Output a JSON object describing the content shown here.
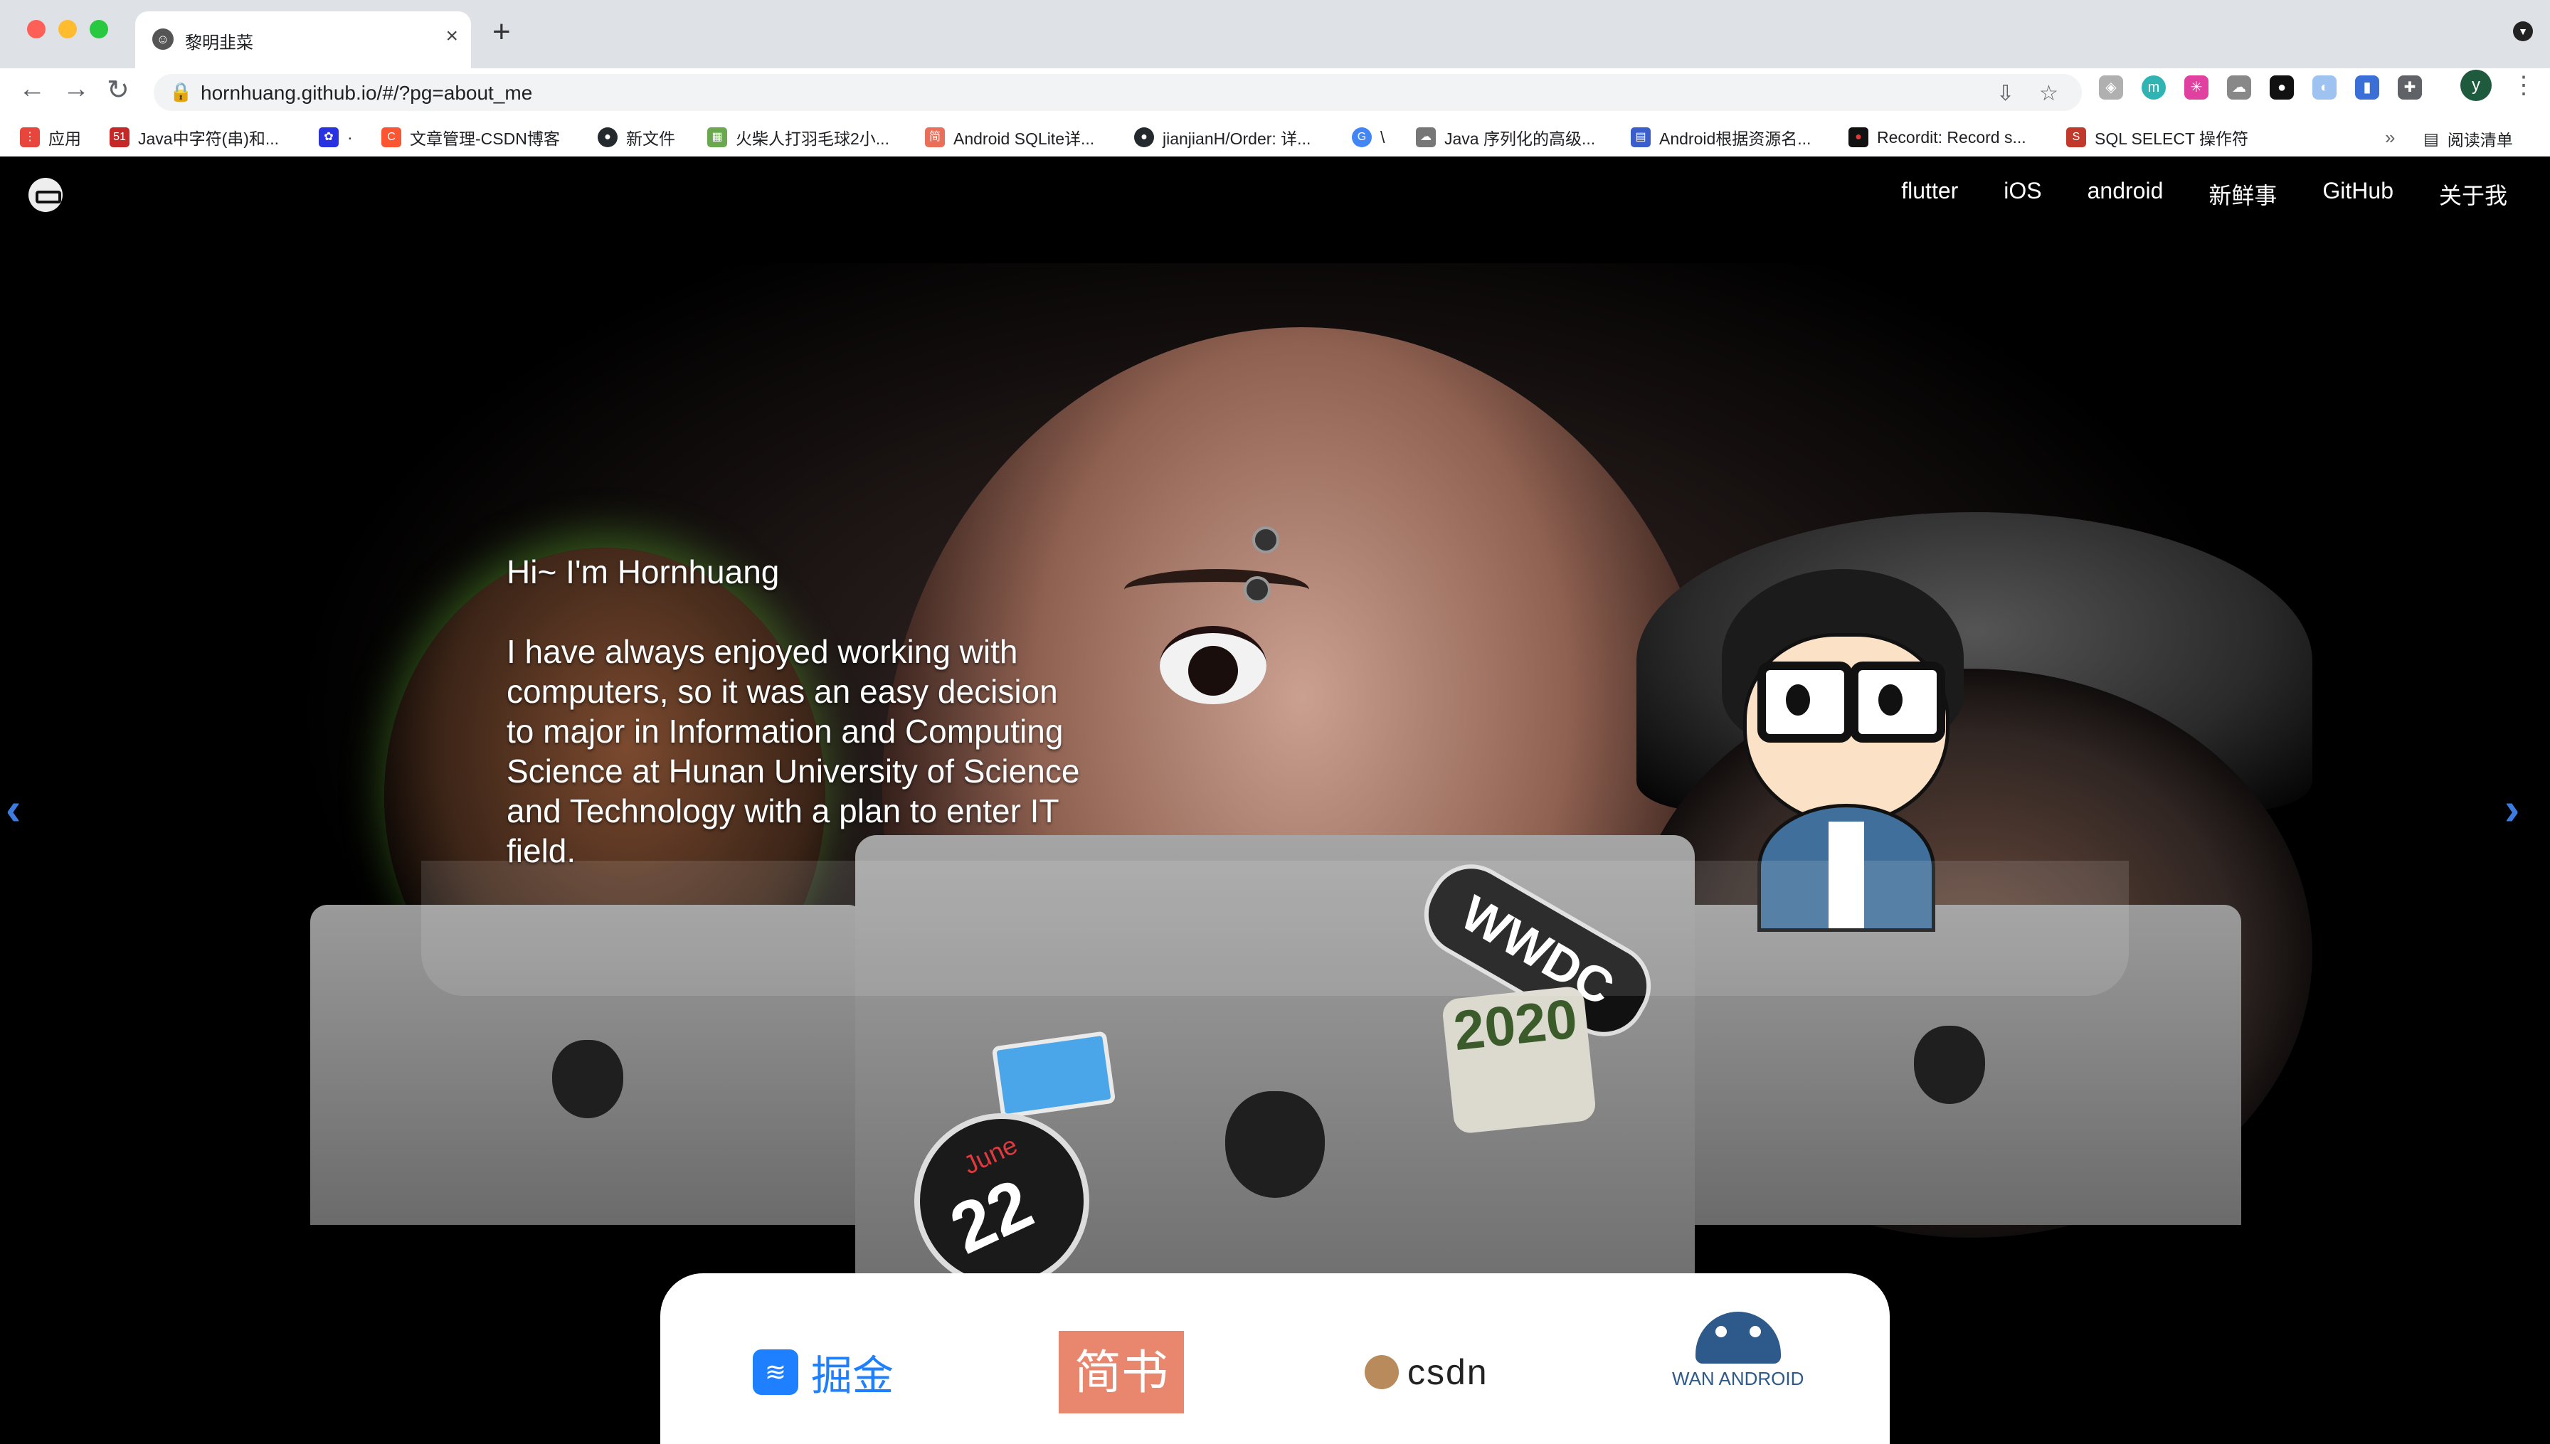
{
  "browser": {
    "tab_title": "黎明韭菜",
    "url": "hornhuang.github.io/#/?pg=about_me",
    "profile_initial": "y",
    "bookmarks": [
      {
        "label": "应用",
        "icon": "apps-grid-icon",
        "color": "#e8453c"
      },
      {
        "label": "Java中字符(串)和...",
        "icon": "51cto-icon",
        "color": "#c62828"
      },
      {
        "label": "·",
        "icon": "baidu-icon",
        "color": "#2932e1"
      },
      {
        "label": "文章管理-CSDN博客",
        "icon": "csdn-c-icon",
        "color": "#fc5531"
      },
      {
        "label": "新文件",
        "icon": "github-icon",
        "color": "#24292e"
      },
      {
        "label": "火柴人打羽毛球2小...",
        "icon": "game-icon",
        "color": "#6aa84f"
      },
      {
        "label": "Android SQLite详...",
        "icon": "jianshu-icon",
        "color": "#ea6f5a"
      },
      {
        "label": "jianjianH/Order: 详...",
        "icon": "github-icon",
        "color": "#24292e"
      },
      {
        "label": "\\",
        "icon": "google-icon",
        "color": "#4285f4"
      },
      {
        "label": "Java 序列化的高级...",
        "icon": "cloud-icon",
        "color": "#777777"
      },
      {
        "label": "Android根据资源名...",
        "icon": "doc-icon",
        "color": "#3a5fcd"
      },
      {
        "label": "Recordit: Record s...",
        "icon": "record-icon",
        "color": "#111111"
      },
      {
        "label": "SQL SELECT 操作符",
        "icon": "w3-icon",
        "color": "#c0392b"
      }
    ],
    "more": "»",
    "reading_list": "阅读清单"
  },
  "site": {
    "nav": [
      "flutter",
      "iOS",
      "android",
      "新鲜事",
      "GitHub",
      "关于我"
    ],
    "greeting": "Hi~ I'm Hornhuang",
    "bio": "I have always enjoyed working with computers, so it was an easy decision to major in Information and Computing Science at Hunan University of Science and Technology with a plan to enter IT field.",
    "stickers": {
      "wwdc": "WWDC",
      "year": "2020",
      "month": "June",
      "day": "22"
    },
    "links": {
      "juejin": "掘金",
      "jianshu": "简书",
      "csdn": "csdn",
      "wan_android": "WAN ANDROID"
    },
    "colors": {
      "arrow": "#3c7be0",
      "juejin": "#1e80ff",
      "jianshu": "#e9866e"
    }
  }
}
